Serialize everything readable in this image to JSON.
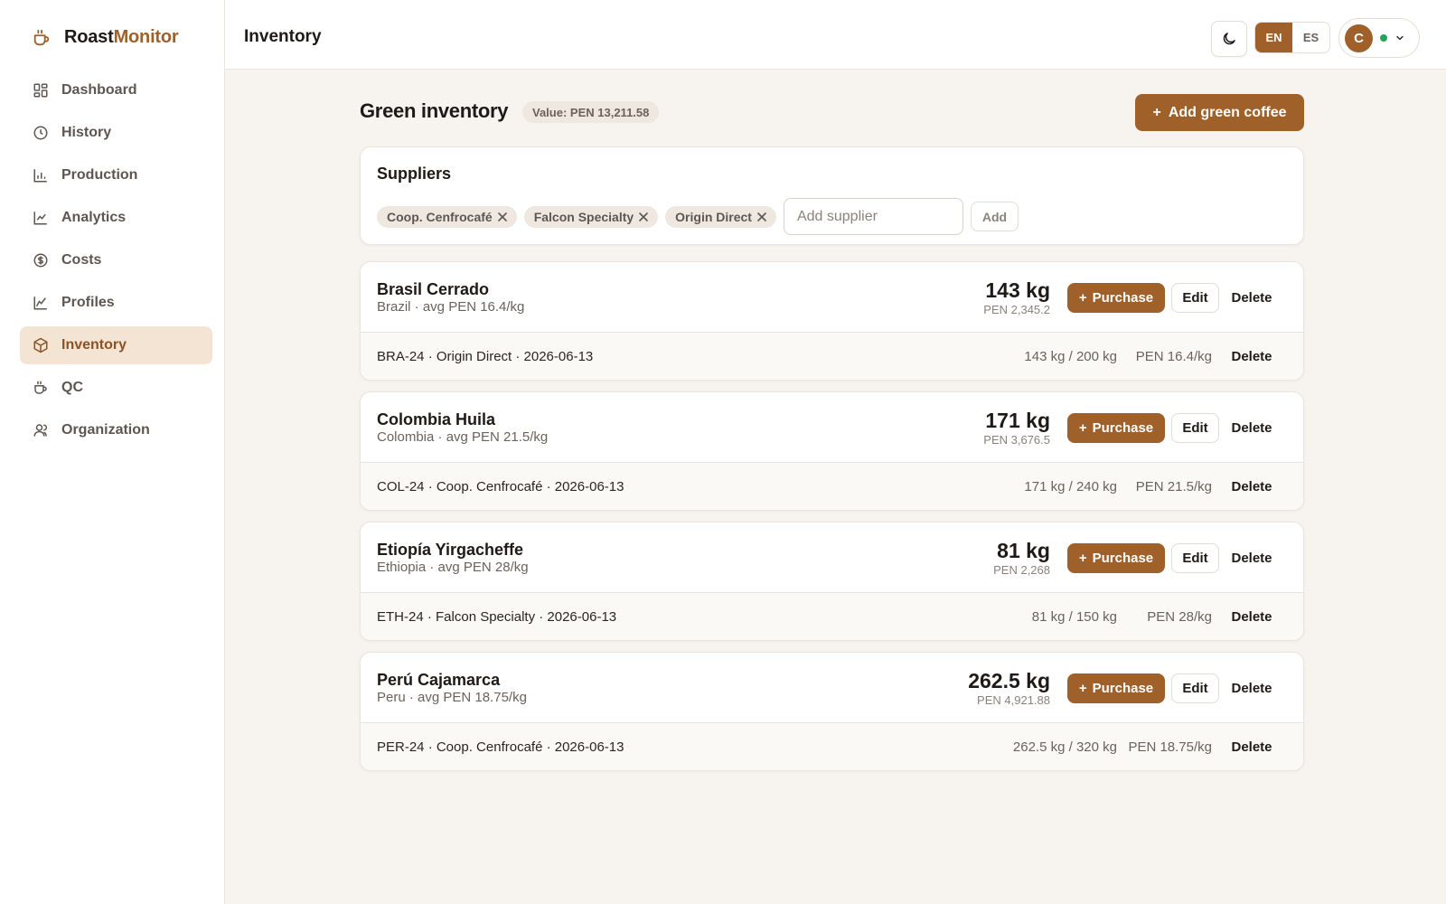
{
  "app": {
    "brand_a": "Roast",
    "brand_b": "Monitor"
  },
  "sidebar": {
    "items": [
      {
        "label": "Dashboard",
        "icon": "dashboard-icon"
      },
      {
        "label": "History",
        "icon": "clock-icon"
      },
      {
        "label": "Production",
        "icon": "bar-chart-icon"
      },
      {
        "label": "Analytics",
        "icon": "line-chart-icon"
      },
      {
        "label": "Costs",
        "icon": "dollar-icon"
      },
      {
        "label": "Profiles",
        "icon": "profile-curve-icon"
      },
      {
        "label": "Inventory",
        "icon": "box-icon",
        "active": true
      },
      {
        "label": "QC",
        "icon": "cup-icon"
      },
      {
        "label": "Organization",
        "icon": "users-icon"
      }
    ]
  },
  "header": {
    "title": "Inventory",
    "lang_en": "EN",
    "lang_es": "ES",
    "avatar_initial": "C"
  },
  "main": {
    "heading": "Green inventory",
    "value_badge": "Value: PEN 13,211.58",
    "add_label": "Add green coffee"
  },
  "suppliers": {
    "title": "Suppliers",
    "chips": [
      "Coop. Cenfrocafé",
      "Falcon Specialty",
      "Origin Direct"
    ],
    "input_placeholder": "Add supplier",
    "add_label": "Add"
  },
  "actions": {
    "purchase": "Purchase",
    "edit": "Edit",
    "delete": "Delete"
  },
  "coffees": [
    {
      "name": "Brasil Cerrado",
      "sub": "Brazil · avg PEN 16.4/kg",
      "qty": "143 kg",
      "value": "PEN 2,345.2",
      "lot": "BRA-24 · Origin Direct · 2026-06-13",
      "lot_qty": "143 kg / 200 kg",
      "lot_price": "PEN 16.4/kg"
    },
    {
      "name": "Colombia Huila",
      "sub": "Colombia · avg PEN 21.5/kg",
      "qty": "171 kg",
      "value": "PEN 3,676.5",
      "lot": "COL-24 · Coop. Cenfrocafé · 2026-06-13",
      "lot_qty": "171 kg / 240 kg",
      "lot_price": "PEN 21.5/kg"
    },
    {
      "name": "Etiopía Yirgacheffe",
      "sub": "Ethiopia · avg PEN 28/kg",
      "qty": "81 kg",
      "value": "PEN 2,268",
      "lot": "ETH-24 · Falcon Specialty · 2026-06-13",
      "lot_qty": "81 kg / 150 kg",
      "lot_price": "PEN 28/kg"
    },
    {
      "name": "Perú Cajamarca",
      "sub": "Peru · avg PEN 18.75/kg",
      "qty": "262.5 kg",
      "value": "PEN 4,921.88",
      "lot": "PER-24 · Coop. Cenfrocafé · 2026-06-13",
      "lot_qty": "262.5 kg / 320 kg",
      "lot_price": "PEN 18.75/kg"
    }
  ],
  "colors": {
    "accent": "#a0602a",
    "active_bg": "#f3e4d4",
    "status_online": "#22a55a"
  }
}
